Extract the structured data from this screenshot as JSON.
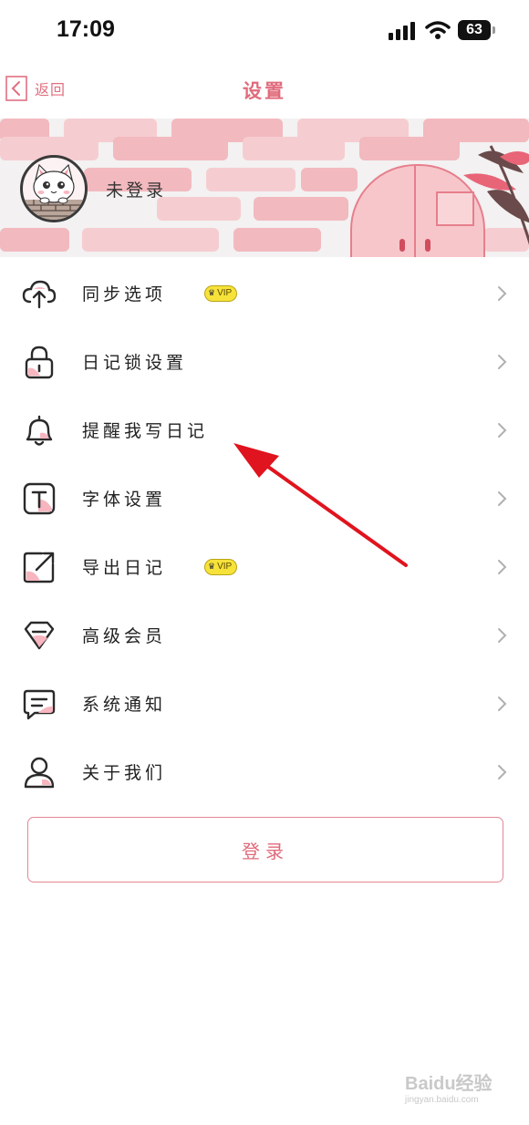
{
  "status_bar": {
    "time": "17:09",
    "battery": "63"
  },
  "nav": {
    "back_label": "返回",
    "title": "设置"
  },
  "profile": {
    "login_status": "未登录"
  },
  "menu": [
    {
      "label": "同步选项",
      "icon": "cloud-upload-icon",
      "vip": "VIP"
    },
    {
      "label": "日记锁设置",
      "icon": "lock-icon"
    },
    {
      "label": "提醒我写日记",
      "icon": "bell-icon"
    },
    {
      "label": "字体设置",
      "icon": "font-icon"
    },
    {
      "label": "导出日记",
      "icon": "export-icon",
      "vip": "VIP"
    },
    {
      "label": "高级会员",
      "icon": "diamond-icon"
    },
    {
      "label": "系统通知",
      "icon": "message-icon"
    },
    {
      "label": "关于我们",
      "icon": "user-icon"
    }
  ],
  "login_button": "登录",
  "colors": {
    "accent": "#e06b7c",
    "pink_light": "#f5cdd1",
    "vip_yellow": "#f7e23a",
    "annotation_red": "#e0141e"
  },
  "watermark": {
    "brand": "Baidu经验",
    "url": "jingyan.baidu.com"
  }
}
